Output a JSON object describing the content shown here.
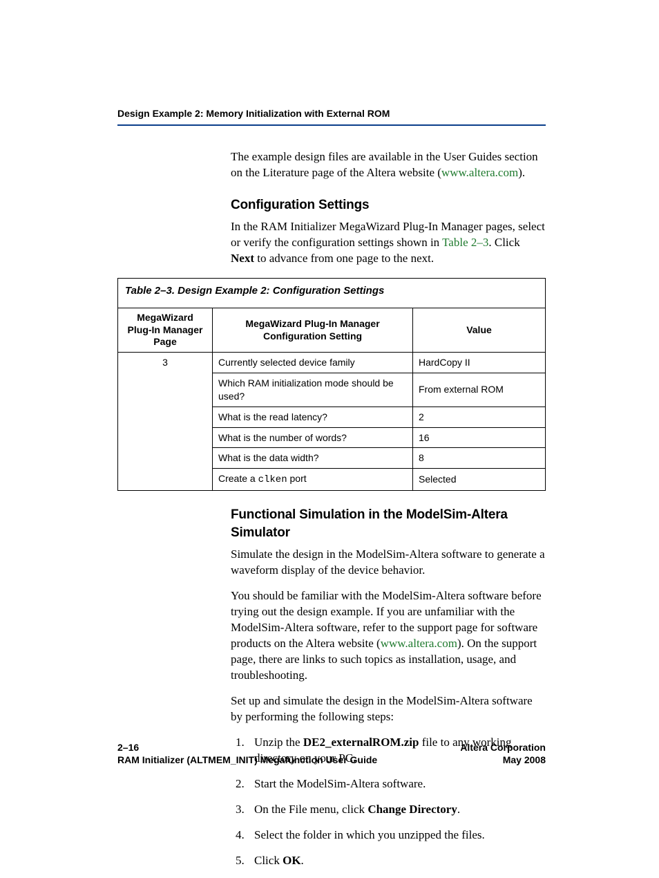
{
  "header": {
    "running": "Design Example 2: Memory Initialization with External ROM"
  },
  "intro": {
    "p1_a": "The example design files are available in the User Guides section on the Literature page of the Altera website (",
    "p1_link": "www.altera.com",
    "p1_b": ")."
  },
  "config": {
    "heading": "Configuration Settings",
    "p1_a": "In the RAM Initializer MegaWizard Plug-In Manager pages, select or verify the configuration settings shown in ",
    "p1_xref": "Table 2–3",
    "p1_b": ". Click ",
    "p1_bold": "Next",
    "p1_c": " to advance from one page to the next."
  },
  "table": {
    "caption": "Table 2–3. Design Example 2: Configuration Settings",
    "head": {
      "page": "MegaWizard Plug-In Manager Page",
      "setting": "MegaWizard Plug-In Manager Configuration Setting",
      "value": "Value"
    },
    "page_num": "3",
    "rows": [
      {
        "setting": "Currently selected device family",
        "value": "HardCopy II"
      },
      {
        "setting": "Which RAM initialization mode should be used?",
        "value": "From external ROM"
      },
      {
        "setting": "What is the read latency?",
        "value": "2"
      },
      {
        "setting": "What is the number of words?",
        "value": "16"
      },
      {
        "setting": "What is the data width?",
        "value": "8"
      },
      {
        "setting_pre": "Create a ",
        "setting_code": "clken",
        "setting_post": " port",
        "value": "Selected"
      }
    ]
  },
  "sim": {
    "heading": "Functional Simulation in the ModelSim-Altera Simulator",
    "p1": "Simulate the design in the ModelSim-Altera software to generate a waveform display of the device behavior.",
    "p2_a": "You should be familiar with the ModelSim-Altera software before trying out the design example. If you are unfamiliar with the ModelSim-Altera software, refer to the support page for software products on the Altera website (",
    "p2_link": "www.altera.com",
    "p2_b": "). On the support page, there are links to such topics as installation, usage, and troubleshooting.",
    "p3": "Set up and simulate the design in the ModelSim-Altera software by performing the following steps:",
    "steps": {
      "s1_a": "Unzip the ",
      "s1_bold": "DE2_externalROM.zip",
      "s1_b": " file to any working directory on your PC.",
      "s2": "Start the ModelSim-Altera software.",
      "s3_a": "On the File menu, click ",
      "s3_bold": "Change Directory",
      "s3_b": ".",
      "s4": "Select the folder in which you unzipped the files.",
      "s5_a": "Click ",
      "s5_bold": "OK",
      "s5_b": "."
    }
  },
  "footer": {
    "page_num": "2–16",
    "guide": "RAM Initializer (ALTMEM_INIT) Megafunction User Guide",
    "company": "Altera Corporation",
    "date": "May 2008"
  }
}
